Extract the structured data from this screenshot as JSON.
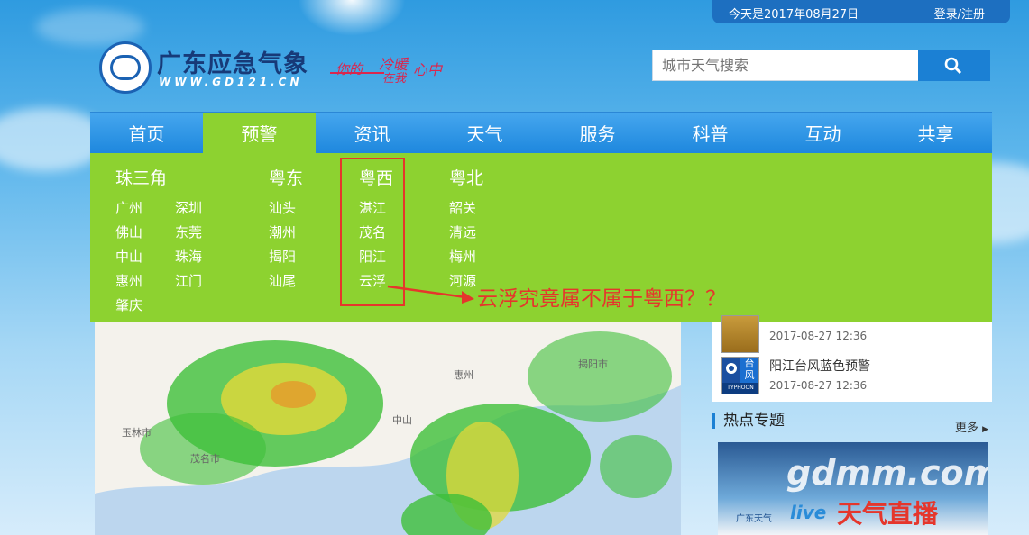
{
  "topbar": {
    "date": "今天是2017年08月27日",
    "login": "登录/注册"
  },
  "logo": {
    "title": "广东应急气象",
    "url": "WWW.GD121.CN"
  },
  "slogan": {
    "part1": "你的",
    "part2": "冷暖",
    "part3": "在我",
    "part4": "心中"
  },
  "search": {
    "placeholder": "城市天气搜索"
  },
  "nav": [
    "首页",
    "预警",
    "资讯",
    "天气",
    "服务",
    "科普",
    "互动",
    "共享"
  ],
  "dropdown": {
    "regions": [
      {
        "name": "珠三角",
        "cities": [
          "广州",
          "深圳",
          "佛山",
          "东莞",
          "中山",
          "珠海",
          "惠州",
          "江门",
          "肇庆"
        ]
      },
      {
        "name": "粤东",
        "cities": [
          "汕头",
          "潮州",
          "揭阳",
          "汕尾"
        ]
      },
      {
        "name": "粤西",
        "cities": [
          "湛江",
          "茂名",
          "阳江",
          "云浮"
        ]
      },
      {
        "name": "粤北",
        "cities": [
          "韶关",
          "清远",
          "梅州",
          "河源"
        ]
      }
    ]
  },
  "annotation": "云浮究竟属不属于粤西？？",
  "map_labels": [
    "揭阳市",
    "惠州",
    "中山",
    "玉林市",
    "茂名市"
  ],
  "warnings": [
    {
      "time": "2017-08-27 12:36",
      "icon": "rainstorm-warning-icon"
    },
    {
      "title": "阳江台风蓝色预警",
      "time": "2017-08-27 12:36",
      "icon": "typhoon-warning-icon",
      "icon_text": "台风",
      "icon_sub": "TYPHOON"
    }
  ],
  "hot": {
    "title": "热点专题",
    "more": "更多",
    "watermark": "gdmm.com",
    "banner_text": "天气直播",
    "banner_brand": "广东天气",
    "banner_live": "live"
  }
}
